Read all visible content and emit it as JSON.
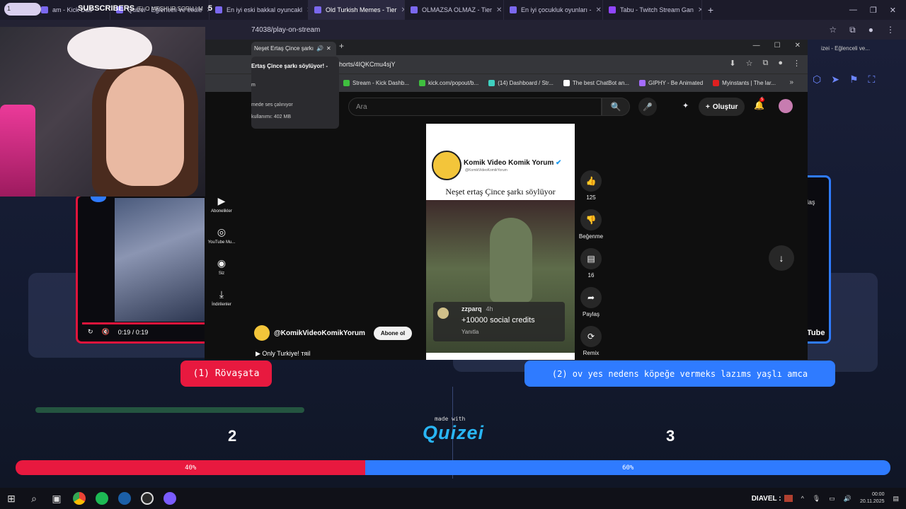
{
  "outer_tabs": [
    {
      "label": "am - Kick Das"
    },
    {
      "label": "Quizei - Eğlenceli ve etkile"
    },
    {
      "label": "En iyi eski bakkal oyuncakl"
    },
    {
      "label": "Old Turkish Memes - Tier",
      "active": true
    },
    {
      "label": "OLMAZSA OLMAZ - Tier"
    },
    {
      "label": "En iyi çocukluk oyunları -"
    },
    {
      "label": "Tabu - Twitch Stream Gan"
    }
  ],
  "outer_tab_newtab": "+",
  "subs_overlay": {
    "label": "SUBSCRIBERS",
    "rest": "(5) O MEŞHUR SORU | M",
    "count": "5",
    "badge": "1"
  },
  "outer_url": "74038/play-on-stream",
  "outer_right_crumb": "izei - Eğlenceli ve...",
  "inner": {
    "tab_label": "Neşet Ertaş Çince şarkı",
    "url": "horts/4IQKCmu4sjY",
    "bookmarks": [
      "Stream - Kick Dashb...",
      "kick.com/popout/b...",
      "(14) Dashboard / Str...",
      "The best ChatBot an...",
      "GIPHY - Be Animated",
      "Myinstants | The lar..."
    ],
    "tab_popup": {
      "title": "Ertaş Çince şarkı söylüyor! -",
      "line2": "m",
      "line3": "mede ses çalınıyor",
      "line4": "kullanımı: 402 MB"
    }
  },
  "youtube": {
    "search_placeholder": "Ara",
    "create_label": "Oluştur",
    "notif_count": "5",
    "left_nav": [
      {
        "icon": "subscriptions-icon",
        "label": "Abonelikler"
      },
      {
        "icon": "youtube-music-icon",
        "label": "YouTube Mu..."
      },
      {
        "icon": "you-icon",
        "label": "Siz"
      },
      {
        "icon": "downloads-icon",
        "label": "İndirilenler"
      }
    ],
    "short": {
      "channel_display": "Komik Video Komik Yorum",
      "channel_handle": "@KomikVideoKomikYorum",
      "title": "Neşet ertaş Çince şarkı söylüyor",
      "comment_user": "zzparq",
      "comment_time": "4h",
      "comment_text": "+10000 social credits",
      "comment_reply": "Yanıtla"
    },
    "actions": [
      {
        "icon": "like-icon",
        "label": "125"
      },
      {
        "icon": "dislike-icon",
        "label": "Beğenme"
      },
      {
        "icon": "comment-icon",
        "label": "16"
      },
      {
        "icon": "share-icon",
        "label": "Paylaş"
      },
      {
        "icon": "remix-icon",
        "label": "Remix"
      }
    ],
    "channel_name": "@KomikVideoKomikYorum",
    "subscribe_label": "Abone ol",
    "caption": "▶ Only Turkiye! тяil"
  },
  "mini_player": {
    "time": "0:19 / 0:19"
  },
  "right_panel": {
    "label": "laş",
    "logo": "Tube"
  },
  "quiz": {
    "answer_left": "(1) Rövaşata",
    "answer_right": "(2) ov yes nedens köpeğe vermeks lazıms yaşlı amca",
    "count_left": "2",
    "count_right": "3",
    "made_with": "made with",
    "logo": "Quizei",
    "vote_left_pct": 40,
    "vote_right_pct": 60,
    "vote_left_label": "40%",
    "vote_right_label": "60%",
    "colors": {
      "left": "#e8193f",
      "right": "#2f7bff"
    }
  },
  "taskbar": {
    "streamer": "DIAVEL :",
    "time": "00:00",
    "date": "20.11.2025"
  }
}
